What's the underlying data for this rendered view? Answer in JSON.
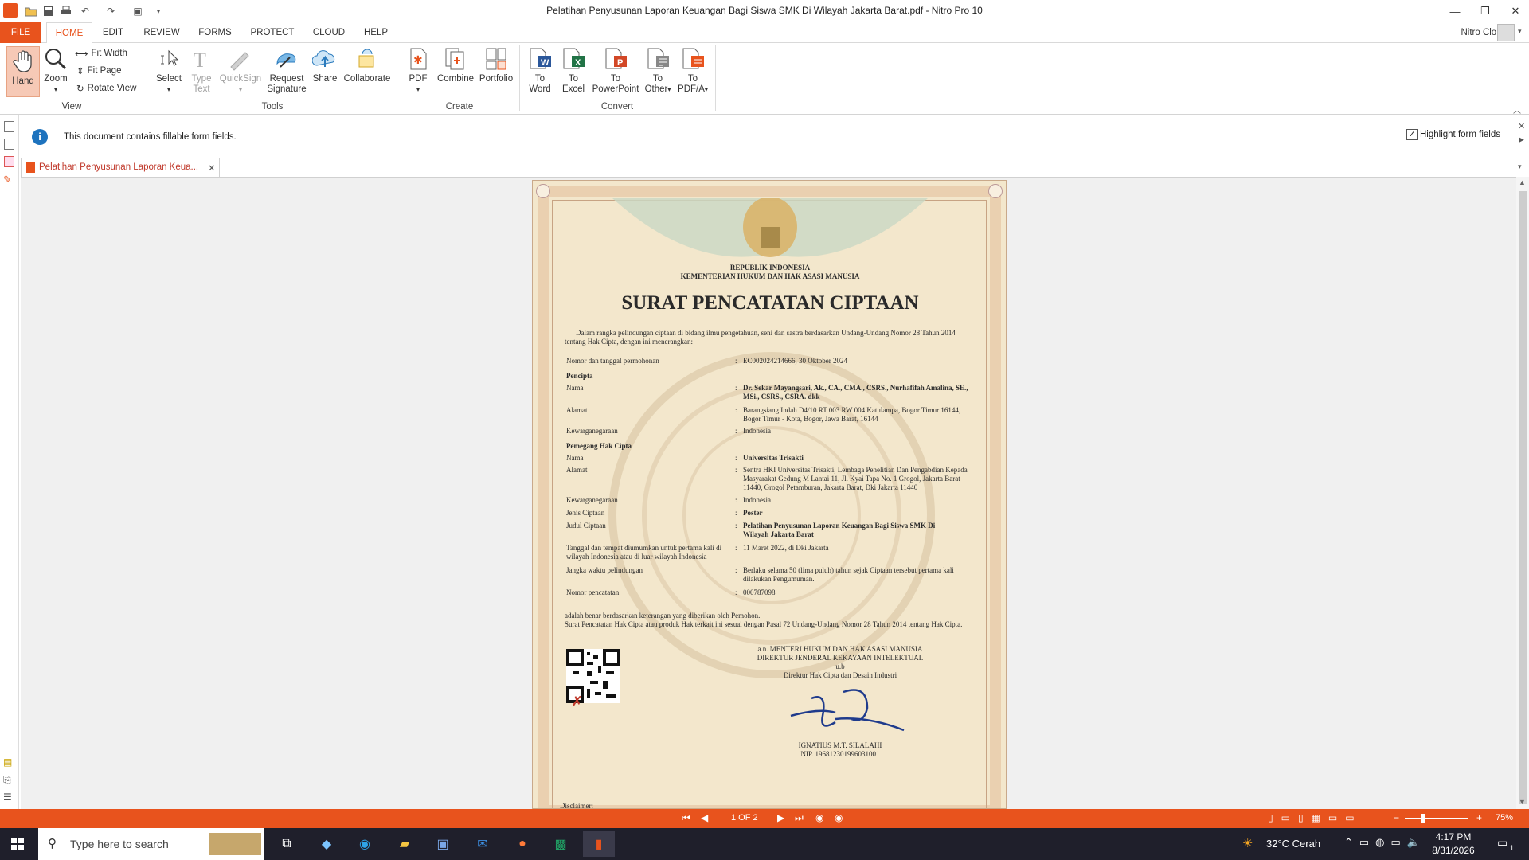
{
  "window": {
    "title": "Pelatihan Penyusunan Laporan Keuangan Bagi Siswa SMK Di Wilayah Jakarta Barat.pdf - Nitro Pro 10"
  },
  "menu": {
    "file": "FILE",
    "tabs": [
      "HOME",
      "EDIT",
      "REVIEW",
      "FORMS",
      "PROTECT",
      "CLOUD",
      "HELP"
    ],
    "account": "Nitro Cloud"
  },
  "ribbon": {
    "view": {
      "hand": "Hand",
      "zoom": "Zoom",
      "fit_width": "Fit Width",
      "fit_page": "Fit Page",
      "rotate_view": "Rotate View",
      "label": "View"
    },
    "tools": {
      "select": "Select",
      "type_text_1": "Type",
      "type_text_2": "Text",
      "quicksign": "QuickSign",
      "request_sig_1": "Request",
      "request_sig_2": "Signature",
      "share": "Share",
      "collaborate": "Collaborate",
      "label": "Tools"
    },
    "create": {
      "pdf": "PDF",
      "combine": "Combine",
      "portfolio": "Portfolio",
      "label": "Create"
    },
    "convert": {
      "to": "To",
      "word": "Word",
      "excel": "Excel",
      "powerpoint": "PowerPoint",
      "other": "Other",
      "pdfa": "PDF/A",
      "label": "Convert"
    }
  },
  "infobar": {
    "message": "This document contains fillable form fields.",
    "highlight": "Highlight form fields"
  },
  "doc_tab": {
    "label": "Pelatihan Penyusunan Laporan Keua..."
  },
  "certificate": {
    "republik": "REPUBLIK INDONESIA",
    "kementerian": "KEMENTERIAN HUKUM DAN HAK ASASI MANUSIA",
    "heading": "SURAT PENCATATAN CIPTAAN",
    "intro": "Dalam rangka pelindungan ciptaan di bidang ilmu pengetahuan, seni dan sastra berdasarkan Undang-Undang Nomor 28 Tahun 2014 tentang Hak Cipta, dengan ini menerangkan:",
    "nomor_label": "Nomor dan tanggal permohonan",
    "nomor_value": "EC002024214666, 30 Oktober 2024",
    "pencipta": "Pencipta",
    "nama_label": "Nama",
    "nama_value": "Dr. Sekar Mayangsari, Ak., CA., CMA., CSRS., Nurhafifah Amalina, SE., MSi., CSRS., CSRA. dkk",
    "alamat_label": "Alamat",
    "alamat_value": "Barangsiang Indah D4/10 RT 003 RW 004 Katulampa, Bogor Timur 16144, Bogor Timur - Kota, Bogor, Jawa Barat, 16144",
    "kewarganegaraan_label": "Kewarganegaraan",
    "kewarganegaraan_value": "Indonesia",
    "pemegang": "Pemegang Hak Cipta",
    "nama2_value": "Universitas Trisakti",
    "alamat2_value": "Sentra HKI Universitas Trisakti, Lembaga Penelitian Dan Pengabdian Kepada Masyarakat Gedung M Lantai 11, Jl. Kyai Tapa No. 1 Grogol, Jakarta Barat 11440, Grogol Petamburan, Jakarta Barat, Dki Jakarta 11440",
    "kewarganegaraan2_value": "Indonesia",
    "jenis_label": "Jenis Ciptaan",
    "jenis_value": "Poster",
    "judul_label": "Judul Ciptaan",
    "judul_value": "Pelatihan Penyusunan Laporan Keuangan Bagi Siswa SMK Di Wilayah Jakarta Barat",
    "tanggal_label": "Tanggal dan tempat diumumkan untuk pertama kali di wilayah Indonesia atau di luar wilayah Indonesia",
    "tanggal_value": "11 Maret 2022, di Dki Jakarta",
    "jangka_label": "Jangka waktu pelindungan",
    "jangka_value": "Berlaku selama 50 (lima puluh) tahun sejak Ciptaan tersebut pertama kali dilakukan Pengumuman.",
    "pencatatan_label": "Nomor pencatatan",
    "pencatatan_value": "000787098",
    "footer1": "adalah benar berdasarkan keterangan yang diberikan oleh Pemohon.",
    "footer2": "Surat Pencatatan Hak Cipta atau produk Hak terkait ini sesuai dengan Pasal 72 Undang-Undang Nomor 28 Tahun 2014 tentang Hak Cipta.",
    "sign1": "a.n. MENTERI HUKUM DAN HAK ASASI MANUSIA",
    "sign2": "DIREKTUR JENDERAL KEKAYAAN INTELEKTUAL",
    "sign3": "u.b",
    "sign4": "Direktur Hak Cipta dan Desain Industri",
    "signer": "IGNATIUS M.T. SILALAHI",
    "nip": "NIP. 196812301996031001",
    "disclaimer": "Disclaimer:"
  },
  "statusbar": {
    "page": "1 OF 2",
    "zoom": "75%"
  },
  "taskbar": {
    "search_placeholder": "Type here to search",
    "weather": "32°C  Cerah",
    "time": "4:17 PM",
    "date": "8/31/2026",
    "notifications": "1"
  },
  "colors": {
    "accent": "#e8531d",
    "page_bg": "#f3e7cc",
    "taskbar": "#1f1f2b"
  }
}
